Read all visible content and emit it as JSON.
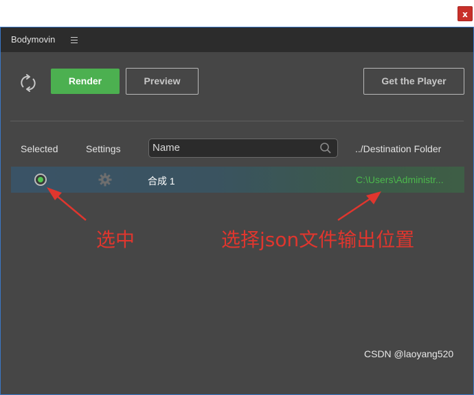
{
  "window": {
    "close_label": "x",
    "title": "Bodymovin"
  },
  "toolbar": {
    "refresh_icon": "refresh-icon",
    "render_label": "Render",
    "preview_label": "Preview",
    "player_label": "Get the Player",
    "render_color": "#4cb050"
  },
  "list_header": {
    "selected": "Selected",
    "settings": "Settings",
    "search_placeholder": "Name",
    "search_value": "",
    "destination": "../Destination Folder"
  },
  "compositions": [
    {
      "name": "合成 1",
      "selected": true,
      "destination": "C:\\Users\\Administr..."
    }
  ],
  "annotations": {
    "select_text": "选中",
    "json_output_text": "选择json文件输出位置",
    "color": "#e0362e"
  },
  "watermark": "CSDN @laoyang520"
}
